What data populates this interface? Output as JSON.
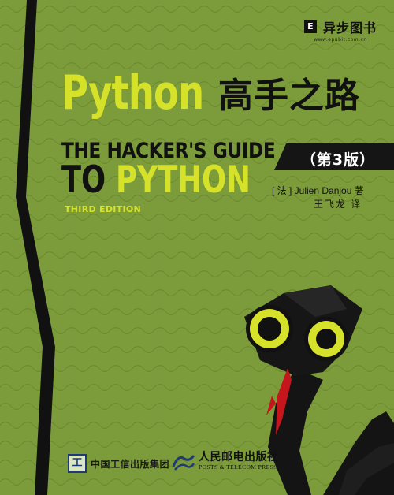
{
  "publisher_logo": {
    "name": "异步图书",
    "url": "www.epubit.com.cn",
    "mark": "E"
  },
  "title": {
    "python": "Python",
    "chinese": "高手之路",
    "english_line1": "THE HACKER'S GUIDE",
    "english_line2_prefix": "TO ",
    "english_line2_python": "PYTHON",
    "edition_en": "THIRD EDITION"
  },
  "edition_badge": "（第3版）",
  "author": "[ 法 ] Julien Danjou  著",
  "translator": "王飞龙  译",
  "footer": {
    "publisher1_name": "中国工信出版集团",
    "publisher1_mark": "工",
    "publisher2_name": "人民邮电出版社",
    "publisher2_en": "POSTS & TELECOM PRESS"
  },
  "colors": {
    "background": "#7c9c3b",
    "accent_yellow": "#d6e22a",
    "snake_black": "#141414",
    "tongue_red": "#c4161c"
  }
}
